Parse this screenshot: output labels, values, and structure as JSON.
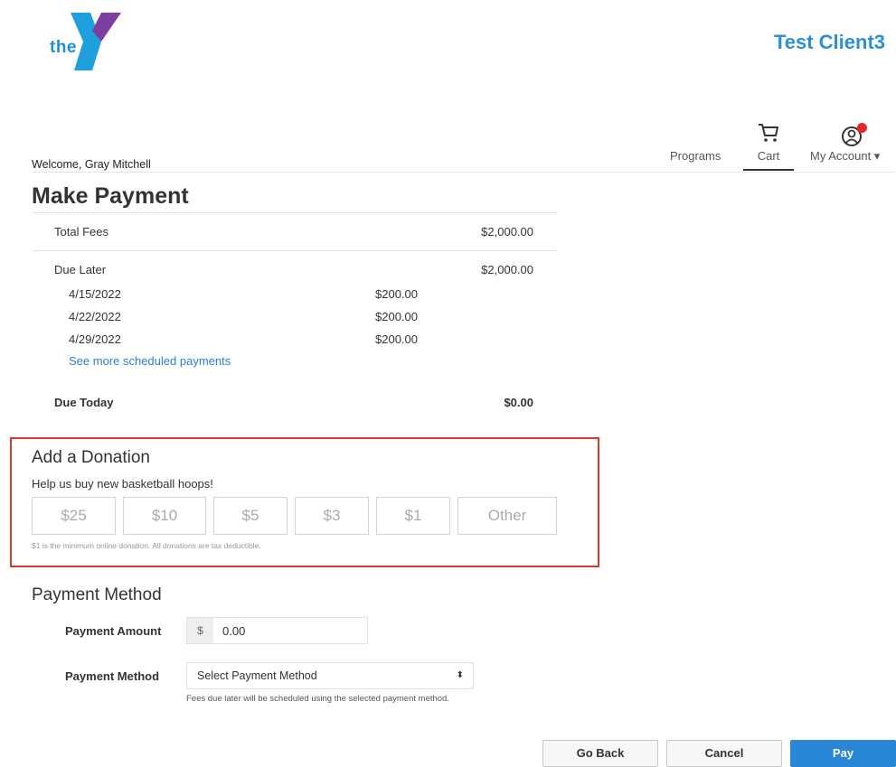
{
  "header": {
    "logo_word": "the",
    "client_name": "Test Client3"
  },
  "nav": {
    "welcome": "Welcome, Gray Mitchell",
    "programs": "Programs",
    "cart": "Cart",
    "account": "My Account ▾"
  },
  "page": {
    "title": "Make Payment"
  },
  "summary": {
    "total_label": "Total Fees",
    "total_amount": "$2,000.00",
    "due_later_label": "Due Later",
    "due_later_amount": "$2,000.00",
    "scheduled": [
      {
        "date": "4/15/2022",
        "amount": "$200.00"
      },
      {
        "date": "4/22/2022",
        "amount": "$200.00"
      },
      {
        "date": "4/29/2022",
        "amount": "$200.00"
      }
    ],
    "see_more": "See more scheduled payments",
    "due_today_label": "Due Today",
    "due_today_amount": "$0.00"
  },
  "donation": {
    "title": "Add a Donation",
    "subtitle": "Help us buy new basketball hoops!",
    "options": [
      "$25",
      "$10",
      "$5",
      "$3",
      "$1",
      "Other"
    ],
    "note": "$1 is the minimum online donation. All donations are tax deductible.",
    "highlight_color": "#e0392b"
  },
  "payment_method": {
    "title": "Payment Method",
    "amount_label": "Payment Amount",
    "currency_prefix": "$",
    "amount_value": "0.00",
    "method_label": "Payment Method",
    "method_selected": "Select Payment Method",
    "note": "Fees due later will be scheduled using the selected payment method."
  },
  "actions": {
    "go_back": "Go Back",
    "cancel": "Cancel",
    "pay": "Pay"
  },
  "colors": {
    "brand_blue": "#2e8ed6",
    "link_blue": "#2a7fd4",
    "primary_button": "#2a86d6",
    "notification_dot": "#e8262a"
  }
}
